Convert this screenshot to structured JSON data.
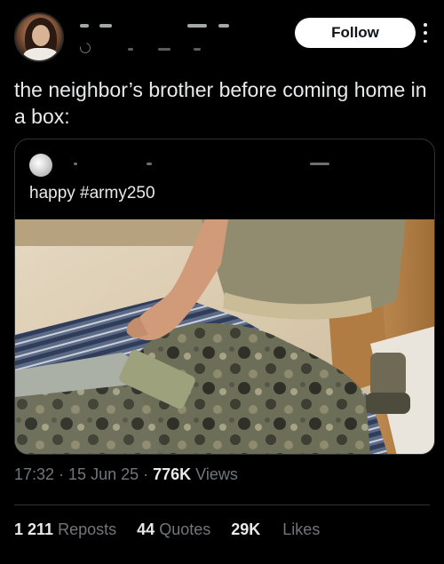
{
  "follow_label": "Follow",
  "tweet_text": "the neighbor’s brother before coming home in a box:",
  "quoted": {
    "text": "happy #army250"
  },
  "meta": {
    "time": "17:32",
    "sep1": " · ",
    "date": "15 Jun 25",
    "sep2": " · ",
    "views_count": "776K",
    "views_label": " Views"
  },
  "stats": {
    "reposts_count": "1 211",
    "reposts_label": "Reposts",
    "quotes_count": "44",
    "quotes_label": "Quotes",
    "likes_count": "29K",
    "likes_label": "Likes"
  },
  "colors": {
    "background": "#000000",
    "text": "#e7e9ea",
    "muted": "#71767b",
    "border": "#2f3336",
    "follow_bg": "#ffffff"
  },
  "icons": {
    "more": "more-vertical-icon",
    "handle": "refresh-icon"
  }
}
